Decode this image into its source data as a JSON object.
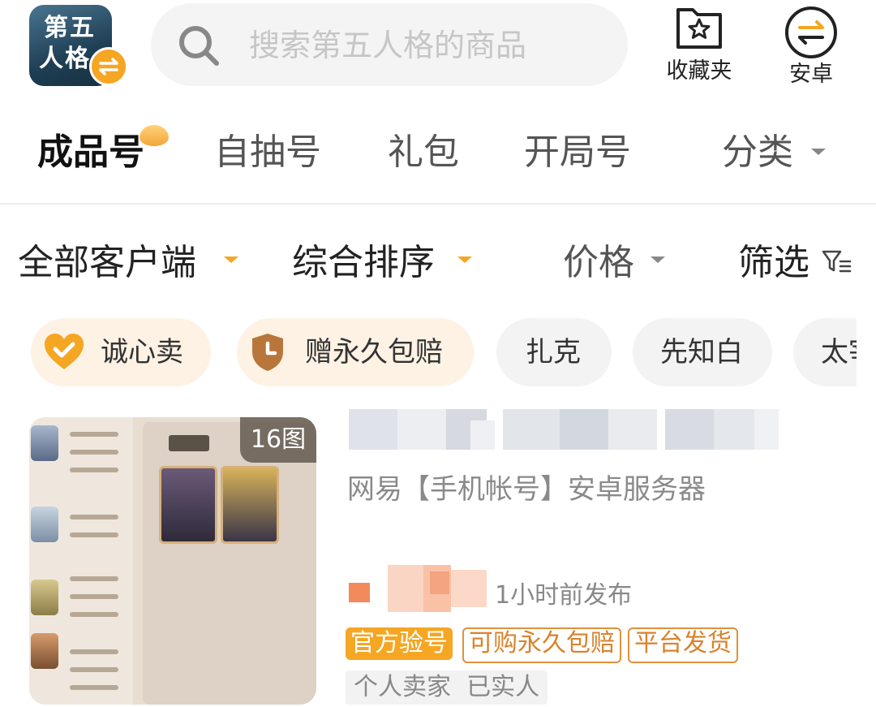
{
  "header": {
    "app_icon": {
      "line1": "第五",
      "line2": "人格"
    },
    "search": {
      "placeholder": "搜索第五人格的商品"
    },
    "favorites_label": "收藏夹",
    "platform_label": "安卓"
  },
  "category_tabs": [
    {
      "label": "成品号",
      "active": true
    },
    {
      "label": "自抽号",
      "active": false
    },
    {
      "label": "礼包",
      "active": false
    },
    {
      "label": "开局号",
      "active": false
    },
    {
      "label": "分类",
      "active": false
    }
  ],
  "filters": {
    "client": "全部客户端",
    "sort": "综合排序",
    "price": "价格",
    "screen": "筛选"
  },
  "chips": [
    {
      "label": "诚心卖",
      "icon": "heart-check-icon"
    },
    {
      "label": "赠永久包赔",
      "icon": "shield-clock-icon"
    },
    {
      "label": "扎克"
    },
    {
      "label": "先知白"
    },
    {
      "label": "太宰"
    }
  ],
  "listing": {
    "image_count": "16图",
    "subtitle": "网易【手机帐号】安卓服务器",
    "posted": "1小时前发布",
    "tags": [
      "官方验号",
      "可购永久包赔",
      "平台发货"
    ],
    "seller": "个人卖家  已实人"
  },
  "colors": {
    "accent": "#f5a623",
    "tag_outline": "#e0913a",
    "text_muted": "#888888"
  }
}
